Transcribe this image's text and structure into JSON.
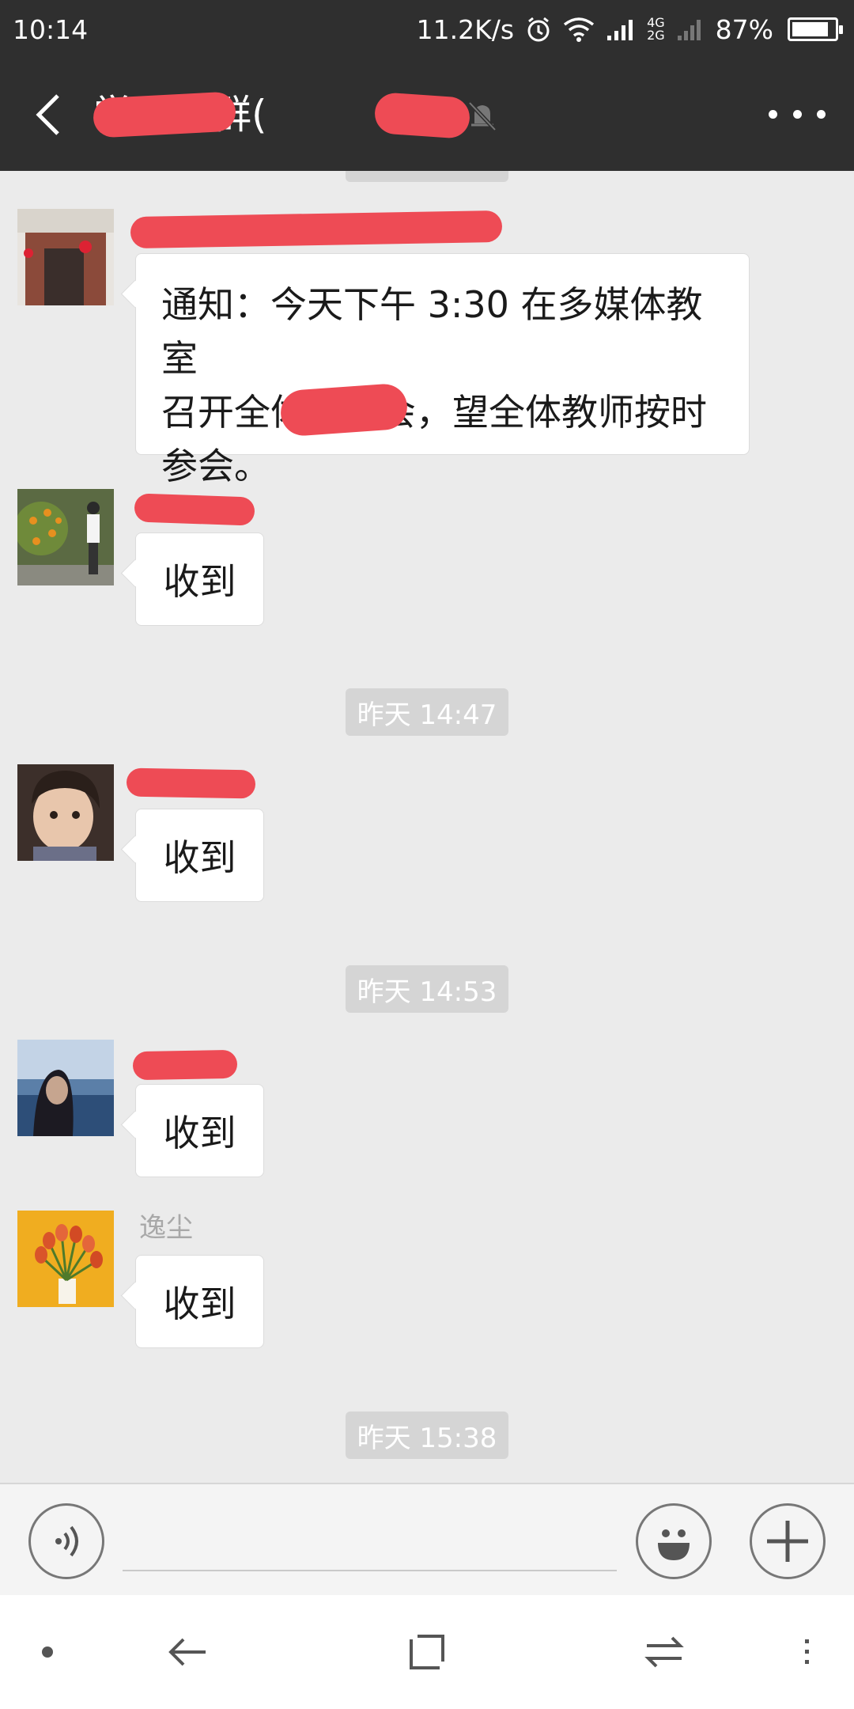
{
  "status_bar": {
    "time": "10:14",
    "net_speed": "11.2K/s",
    "net_type_top": "4G",
    "net_type_bottom": "2G",
    "battery_text": "87%",
    "battery_level": 0.87
  },
  "header": {
    "title": "学工作群(",
    "back_icon": "chevron-left-icon",
    "mute_icon": "bell-off-icon",
    "more_icon": "more-dots-icon"
  },
  "messages": [
    {
      "sender": "",
      "text_line1": "通知：今天下午 3:30 在多媒体教室",
      "text_line2": "召开全体教师会，望全体教师按时",
      "text_line3": "参会。"
    },
    {
      "sender": "",
      "text": "收到"
    },
    {
      "sender": "",
      "text": "收到"
    },
    {
      "sender": "",
      "text": "收到"
    },
    {
      "sender": "逸尘",
      "text": "收到"
    }
  ],
  "timestamps": [
    "昨天 14:47",
    "昨天 14:53",
    "昨天 15:38"
  ],
  "input": {
    "value": "",
    "voice_icon": "voice-icon",
    "emoji_icon": "emoji-icon",
    "plus_icon": "plus-icon"
  },
  "nav": {
    "icons": [
      "dot-icon",
      "back-arrow-icon",
      "square-icon",
      "switch-icon",
      "menu-icon"
    ]
  },
  "colors": {
    "header_bg": "#2f2f2f",
    "chat_bg": "#ebebeb",
    "redaction": "#ee4b55"
  }
}
